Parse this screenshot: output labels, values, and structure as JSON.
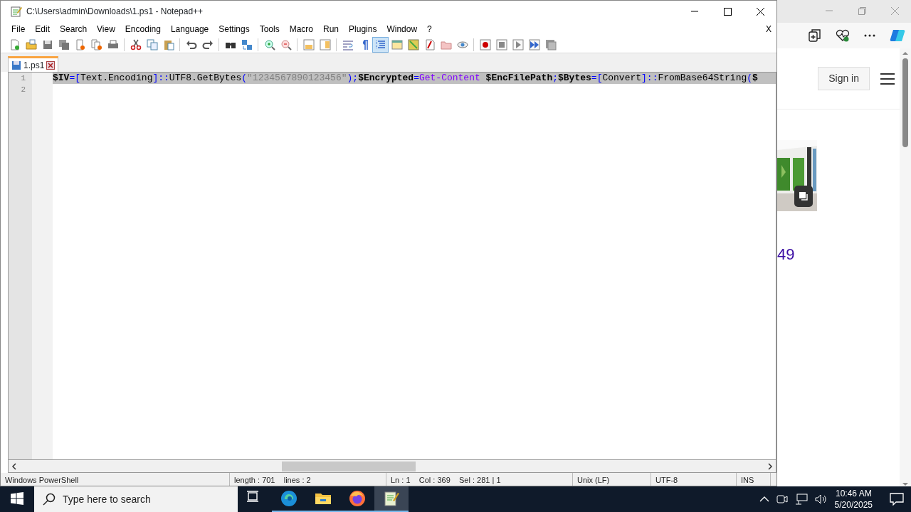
{
  "window": {
    "title": "C:\\Users\\admin\\Downloads\\1.ps1 - Notepad++",
    "close_doc": "X"
  },
  "menu": [
    "File",
    "Edit",
    "Search",
    "View",
    "Encoding",
    "Language",
    "Settings",
    "Tools",
    "Macro",
    "Run",
    "Plugins",
    "Window",
    "?"
  ],
  "toolbar": [
    {
      "kind": "new",
      "pressed": false
    },
    {
      "kind": "open",
      "pressed": false
    },
    {
      "kind": "save",
      "pressed": false
    },
    {
      "kind": "saveall",
      "pressed": false
    },
    {
      "kind": "close",
      "pressed": false
    },
    {
      "kind": "closeall",
      "pressed": false
    },
    {
      "kind": "print",
      "pressed": false
    },
    {
      "kind": "sep"
    },
    {
      "kind": "cut",
      "pressed": false
    },
    {
      "kind": "copy",
      "pressed": false
    },
    {
      "kind": "paste",
      "pressed": false
    },
    {
      "kind": "sep"
    },
    {
      "kind": "undo",
      "pressed": false
    },
    {
      "kind": "redo",
      "pressed": false
    },
    {
      "kind": "sep"
    },
    {
      "kind": "find",
      "pressed": false
    },
    {
      "kind": "replace",
      "pressed": false
    },
    {
      "kind": "sep"
    },
    {
      "kind": "zoomin",
      "pressed": false
    },
    {
      "kind": "zoomout",
      "pressed": false
    },
    {
      "kind": "sep"
    },
    {
      "kind": "syncv",
      "pressed": false
    },
    {
      "kind": "synch",
      "pressed": false
    },
    {
      "kind": "sep"
    },
    {
      "kind": "wrap",
      "pressed": false
    },
    {
      "kind": "allchars",
      "pressed": false
    },
    {
      "kind": "indent",
      "pressed": true
    },
    {
      "kind": "udl",
      "pressed": false
    },
    {
      "kind": "docmap",
      "pressed": false
    },
    {
      "kind": "funclist",
      "pressed": false
    },
    {
      "kind": "folderws",
      "pressed": false
    },
    {
      "kind": "monitor",
      "pressed": false
    },
    {
      "kind": "sep"
    },
    {
      "kind": "rec",
      "pressed": false
    },
    {
      "kind": "stop",
      "pressed": false
    },
    {
      "kind": "play",
      "pressed": false
    },
    {
      "kind": "playmulti",
      "pressed": false
    },
    {
      "kind": "savemacro",
      "pressed": false
    }
  ],
  "tabs": [
    {
      "label": "1.ps1",
      "selected": true
    }
  ],
  "editor": {
    "lines": [
      {
        "number": "1",
        "selected": true,
        "tokens": [
          {
            "kind": "variable",
            "text": "$IV"
          },
          {
            "kind": "operator",
            "text": "=["
          },
          {
            "kind": "plain",
            "text": "Text.Encoding"
          },
          {
            "kind": "operator",
            "text": "]::"
          },
          {
            "kind": "plain",
            "text": "UTF8.GetBytes"
          },
          {
            "kind": "operator",
            "text": "("
          },
          {
            "kind": "string",
            "text": "\"1234567890123456\""
          },
          {
            "kind": "operator",
            "text": ");"
          },
          {
            "kind": "variable",
            "text": "$Encrypted"
          },
          {
            "kind": "operator",
            "text": "="
          },
          {
            "kind": "cmdlet",
            "text": "Get-Content "
          },
          {
            "kind": "variable",
            "text": "$EncFilePath"
          },
          {
            "kind": "operator",
            "text": ";"
          },
          {
            "kind": "variable",
            "text": "$Bytes"
          },
          {
            "kind": "operator",
            "text": "=["
          },
          {
            "kind": "plain",
            "text": "Convert"
          },
          {
            "kind": "operator",
            "text": "]::"
          },
          {
            "kind": "plain",
            "text": "FromBase64String"
          },
          {
            "kind": "operator",
            "text": "("
          },
          {
            "kind": "variable",
            "text": "$"
          }
        ]
      },
      {
        "number": "2",
        "selected": false
      }
    ]
  },
  "status_bar": [
    "Windows PowerShell",
    "length : 701    lines : 2",
    "Ln : 1    Col : 369    Sel : 281 | 1",
    "Unix (LF)",
    "UTF-8",
    "INS"
  ],
  "browser": {
    "sign_in": "Sign in",
    "price": "49"
  },
  "taskbar": {
    "search_placeholder": "Type here to search",
    "apps": [
      {
        "kind": "taskview",
        "active": false
      },
      {
        "kind": "edge",
        "active": false
      },
      {
        "kind": "explorer",
        "active": false
      },
      {
        "kind": "firefox",
        "active": false
      },
      {
        "kind": "notepad",
        "active": true
      }
    ],
    "time": "10:46 AM",
    "date": "5/20/2025"
  }
}
